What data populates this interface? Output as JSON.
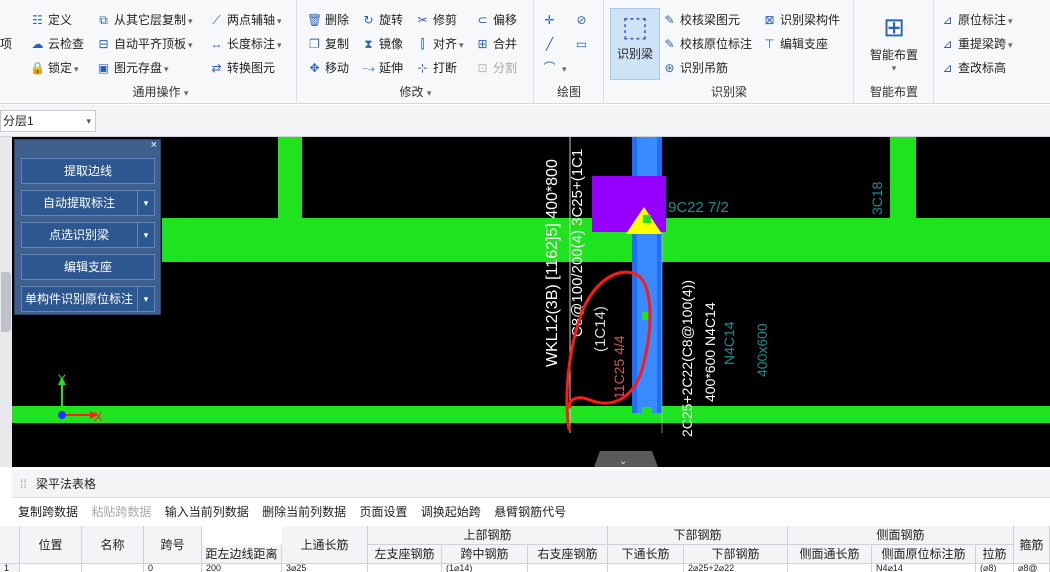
{
  "ribbon": {
    "left_cut": "项",
    "general_ops": {
      "col1": [
        "定义",
        "云检查",
        "锁定"
      ],
      "col2": [
        "从其它层复制",
        "自动平齐顶板",
        "图元存盘"
      ],
      "col3": [
        "两点辅轴",
        "长度标注",
        "转换图元"
      ],
      "label": "通用操作"
    },
    "modify": {
      "col1": [
        "删除",
        "复制",
        "移动"
      ],
      "col2": [
        "旋转",
        "镜像",
        "延伸"
      ],
      "col3": [
        "修剪",
        "对齐",
        "打断"
      ],
      "col4": [
        "偏移",
        "合并",
        "分割"
      ],
      "label": "修改"
    },
    "draw": {
      "label": "绘图"
    },
    "recognize": {
      "big_button": "识别梁",
      "items": [
        "校核梁图元",
        "校核原位标注",
        "识别吊筋"
      ],
      "component": [
        "识别梁构件",
        "编辑支座"
      ],
      "label": "识别梁"
    },
    "smart": {
      "big_button": "智能布置",
      "label": "智能布置"
    },
    "right": [
      "原位标注",
      "重提梁跨",
      "查改标高"
    ]
  },
  "layer": {
    "selected": "分层1"
  },
  "panel": {
    "buttons": [
      "提取边线",
      "自动提取标注",
      "点选识别梁",
      "编辑支座",
      "单构件识别原位标注"
    ]
  },
  "canvas_text": {
    "beam_label": "WKL12(3B) [1162]5] 400*800",
    "stirrup": "C8@100/200(4) 3C25+(1C1",
    "sub1": "(1C14)",
    "sub2": "11C25 4/4",
    "right_label": "9C22 7/2",
    "far_right": "3C18",
    "vert_b1": "2C25+2C22(C8@100(4))",
    "vert_b2": "400*600 N4C14",
    "vert_b3": "N4C14",
    "vert_b4": "400x600",
    "axis_y": "Y",
    "axis_x": "X"
  },
  "table_panel": {
    "title": "梁平法表格",
    "toolbar": [
      "复制跨数据",
      "粘贴跨数据",
      "输入当前列数据",
      "删除当前列数据",
      "页面设置",
      "调换起始跨",
      "悬臂钢筋代号"
    ],
    "group_headers": [
      "上部钢筋",
      "下部钢筋",
      "侧面钢筋"
    ],
    "columns": [
      "位置",
      "名称",
      "跨号",
      "距左边线距离",
      "上通长筋",
      "左支座钢筋",
      "跨中钢筋",
      "右支座钢筋",
      "下通长筋",
      "下部钢筋",
      "侧面通长筋",
      "侧面原位标注筋",
      "拉筋",
      "箍筋"
    ],
    "row": [
      "1",
      "",
      "0",
      "200",
      "3⌀25",
      "",
      "(1⌀14)",
      "",
      "",
      "2⌀25+2⌀22",
      "",
      "N4⌀14",
      "(⌀8)",
      "⌀8@"
    ]
  },
  "colors": {
    "beam": "#1ee31e",
    "column": "#1f6fff",
    "pier": "#9600ff",
    "marker": "#ffff00"
  }
}
